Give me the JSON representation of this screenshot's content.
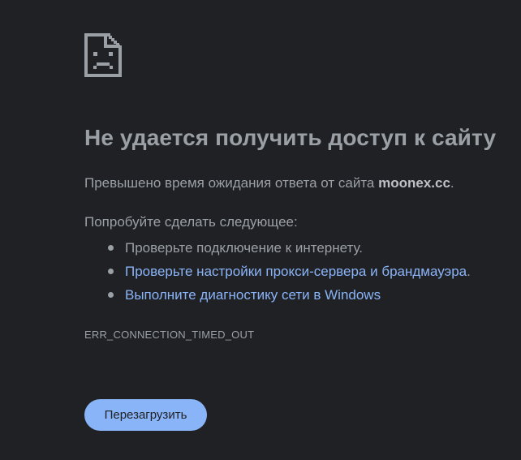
{
  "colors": {
    "background": "#202124",
    "text": "#9aa0a6",
    "link": "#8ab4f8",
    "button_bg": "#8ab4f8",
    "button_text": "#202124"
  },
  "icon": {
    "name": "sad-page-icon"
  },
  "error": {
    "title": "Не удается получить доступ к сайту",
    "summary_prefix": "Превышено время ожидания ответа от сайта",
    "host": "moonex.cc",
    "summary_suffix": ".",
    "suggestions_heading": "Попробуйте сделать следующее:",
    "suggestions": [
      {
        "text": "Проверьте подключение к интернету.",
        "link": false
      },
      {
        "text": "Проверьте настройки прокси-сервера и брандмауэра",
        "suffix": ".",
        "link": true
      },
      {
        "text": "Выполните диагностику сети в Windows",
        "link": true
      }
    ],
    "code": "ERR_CONNECTION_TIMED_OUT"
  },
  "actions": {
    "reload_label": "Перезагрузить"
  }
}
